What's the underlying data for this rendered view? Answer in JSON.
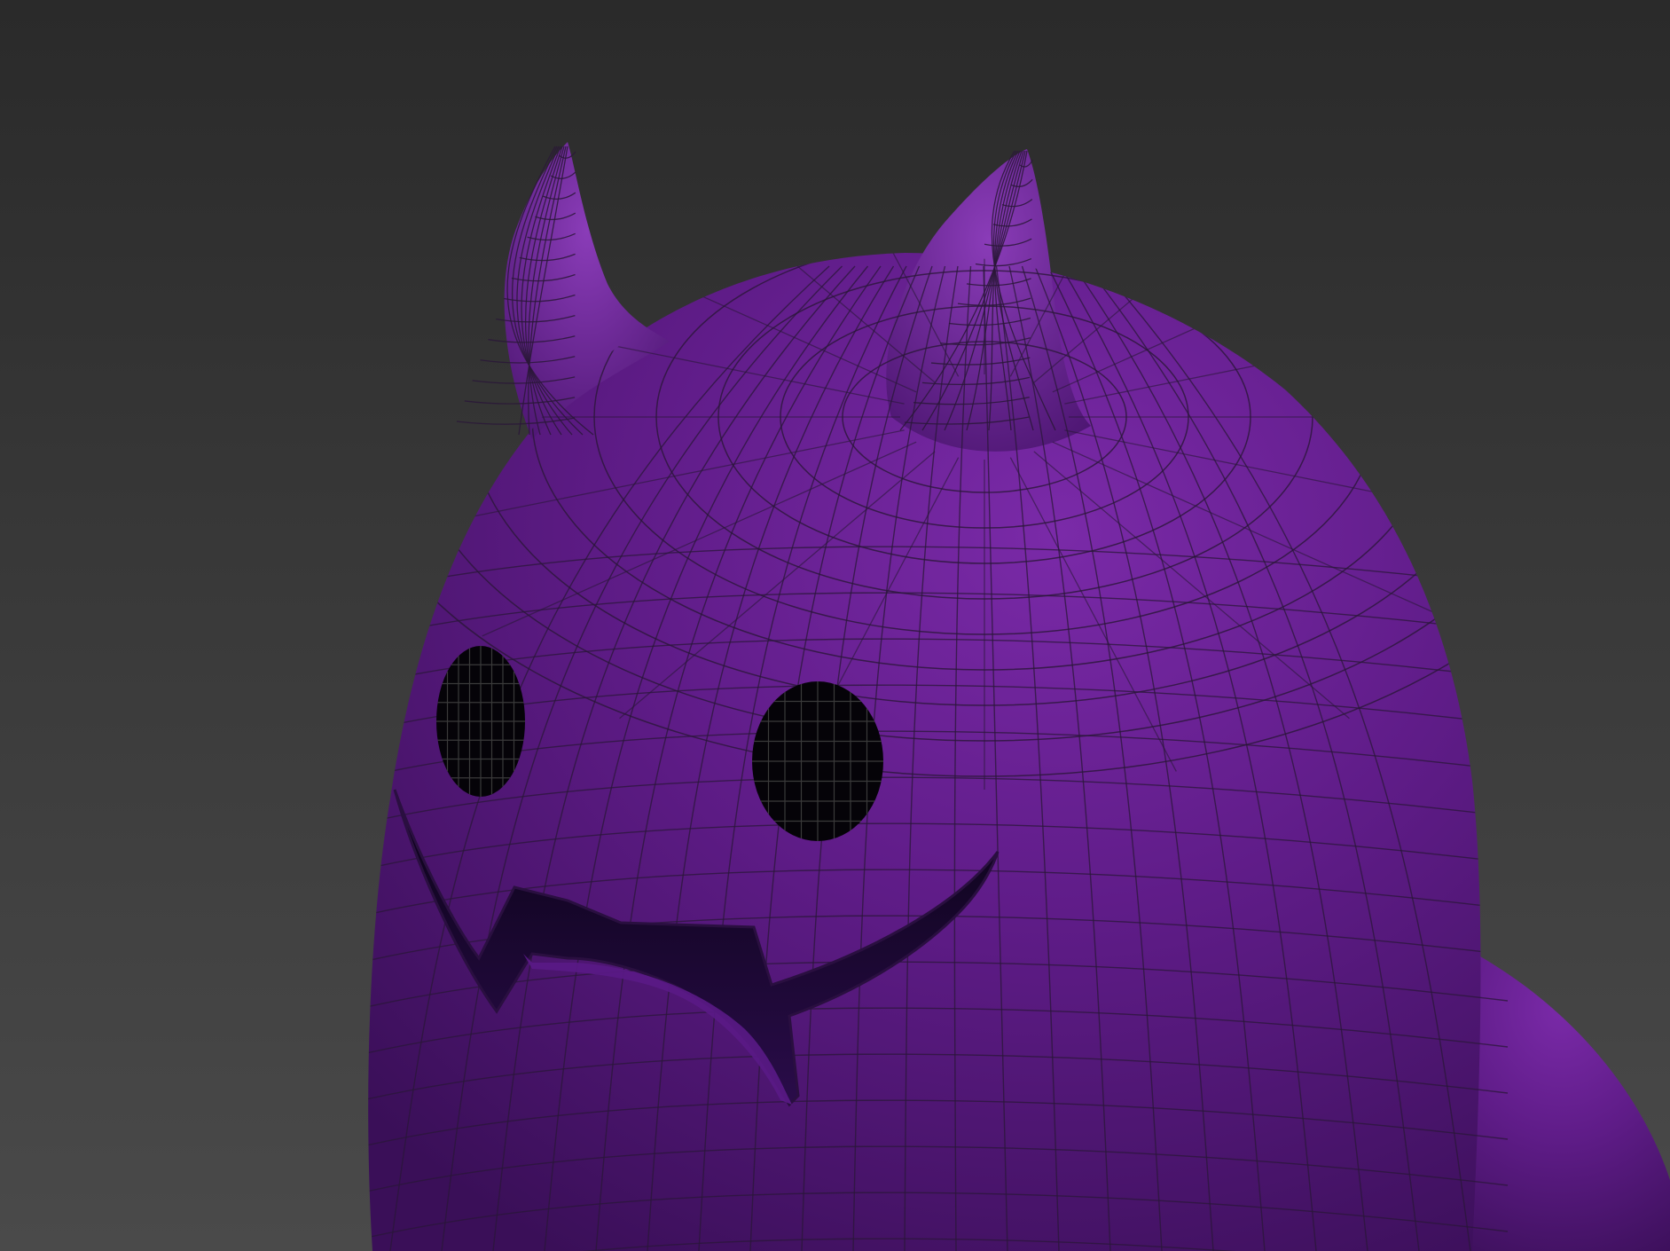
{
  "viewport": {
    "background_top": "#2a2a2a",
    "background_bottom": "#4a4a4a",
    "model": {
      "subject": "purple-devil-ghost-character",
      "shaded_with_wireframe": true,
      "colors": {
        "body_light": "#7a2aa8",
        "body_mid": "#5f1c88",
        "body_dark": "#3a0f58",
        "eye_fill": "#050308",
        "mouth_inner": "#120524",
        "wire": "#2a1738"
      }
    }
  }
}
